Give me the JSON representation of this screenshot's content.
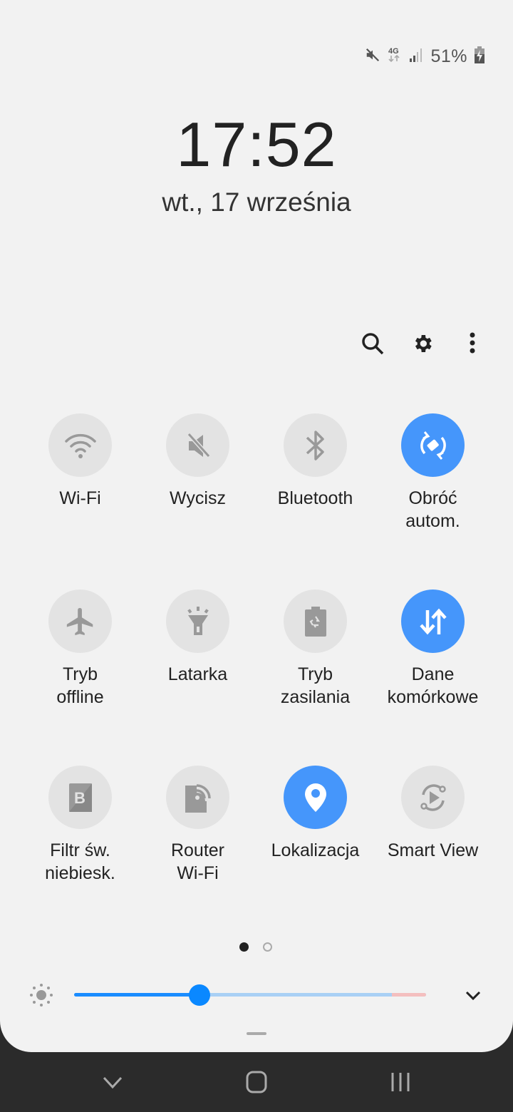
{
  "status_bar": {
    "icons": [
      "mute-icon",
      "4g-data-icon",
      "signal-icon",
      "battery-charging-icon"
    ],
    "network_type": "4G",
    "battery_percent": "51%"
  },
  "clock": {
    "time": "17:52",
    "date": "wt., 17 września"
  },
  "toolbar": {
    "items": [
      {
        "icon": "search-icon",
        "label": "Search"
      },
      {
        "icon": "gear-icon",
        "label": "Settings"
      },
      {
        "icon": "more-vert-icon",
        "label": "More options"
      }
    ]
  },
  "quick_settings": {
    "tiles": [
      {
        "label": "Wi-Fi",
        "icon": "wifi-icon",
        "active": false
      },
      {
        "label": "Wycisz",
        "icon": "mute-icon",
        "active": false
      },
      {
        "label": "Bluetooth",
        "icon": "bluetooth-icon",
        "active": false
      },
      {
        "label": "Obróć\nautom.",
        "icon": "auto-rotate-icon",
        "active": true
      },
      {
        "label": "Tryb\noffline",
        "icon": "airplane-icon",
        "active": false
      },
      {
        "label": "Latarka",
        "icon": "flashlight-icon",
        "active": false
      },
      {
        "label": "Tryb\nzasilania",
        "icon": "power-mode-icon",
        "active": false
      },
      {
        "label": "Dane\nkomórkowe",
        "icon": "mobile-data-icon",
        "active": true
      },
      {
        "label": "Filtr św.\nniebiesk.",
        "icon": "blue-light-filter-icon",
        "active": false
      },
      {
        "label": "Router\nWi-Fi",
        "icon": "hotspot-icon",
        "active": false
      },
      {
        "label": "Lokalizacja",
        "icon": "location-icon",
        "active": true
      },
      {
        "label": "Smart View",
        "icon": "smart-view-icon",
        "active": false
      }
    ]
  },
  "pagination": {
    "current": 1,
    "total": 2
  },
  "brightness": {
    "value": 0.356,
    "high_brightness_threshold": 0.903,
    "icon": "sun-icon",
    "expand_icon": "chevron-down-icon"
  },
  "colors": {
    "accent": "#4596fb",
    "slider": "#0a88ff",
    "panel_bg": "#f2f2f2",
    "nav_bg": "#2b2b2b"
  },
  "navigation_bar": {
    "buttons": [
      "back-icon",
      "home-icon",
      "recents-icon"
    ]
  }
}
